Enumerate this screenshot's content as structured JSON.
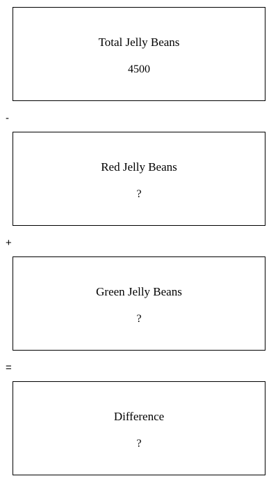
{
  "boxes": [
    {
      "label": "Total Jelly Beans",
      "value": "4500"
    },
    {
      "label": "Red Jelly Beans",
      "value": "?"
    },
    {
      "label": "Green Jelly Beans",
      "value": "?"
    },
    {
      "label": "Difference",
      "value": "?"
    }
  ],
  "operators": [
    "-",
    "+",
    "="
  ]
}
